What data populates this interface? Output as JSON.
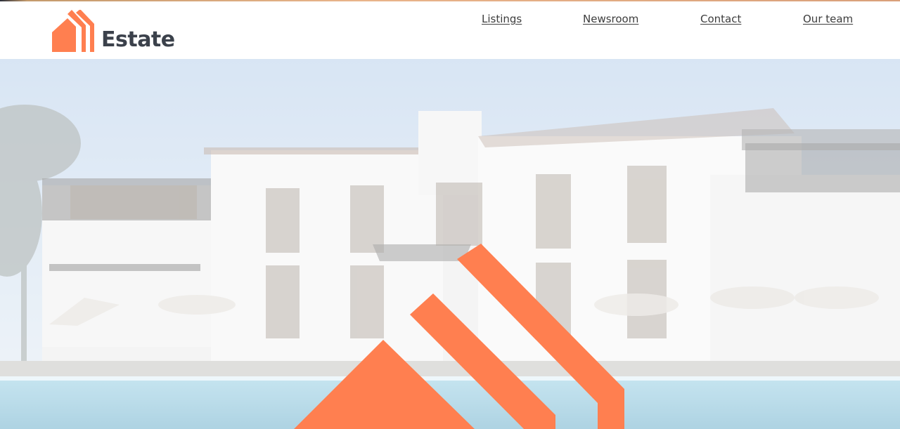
{
  "brand": {
    "name": "Estate",
    "accent_color": "#ff7f50",
    "text_color": "#3b414b"
  },
  "nav": {
    "items": [
      {
        "label": "Listings"
      },
      {
        "label": "Newsroom"
      },
      {
        "label": "Contact"
      },
      {
        "label": "Our team"
      }
    ]
  },
  "hero": {
    "image_alt": "White villa with pool at dusk",
    "watermark_icon": "house-logo-icon"
  }
}
